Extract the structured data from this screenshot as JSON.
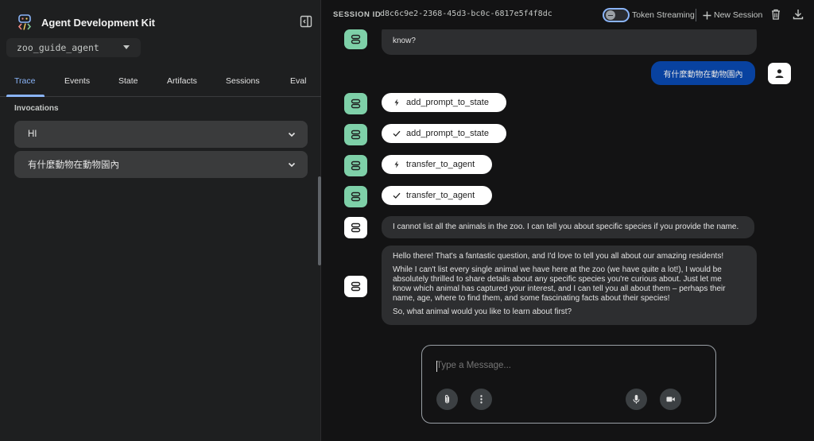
{
  "app": {
    "title": "Agent Development Kit"
  },
  "sidebar": {
    "agent_select": {
      "value": "zoo_guide_agent"
    },
    "tabs": [
      {
        "label": "Trace",
        "active": true
      },
      {
        "label": "Events",
        "active": false
      },
      {
        "label": "State",
        "active": false
      },
      {
        "label": "Artifacts",
        "active": false
      },
      {
        "label": "Sessions",
        "active": false
      },
      {
        "label": "Eval",
        "active": false
      }
    ],
    "invocations_title": "Invocations",
    "invocations": [
      {
        "label": "HI"
      },
      {
        "label": "有什麼動物在動物園內"
      }
    ]
  },
  "topbar": {
    "session_label": "SESSION ID",
    "session_id": "d8c6c9e2-2368-45d3-bc0c-6817e5f4f8dc",
    "token_streaming_label": "Token Streaming",
    "token_streaming_enabled": false,
    "new_session_label": "New Session"
  },
  "chat": {
    "cut_message_tail": "know?",
    "user_message": "有什麼動物在動物園內",
    "tool_calls": [
      {
        "label": "add_prompt_to_state",
        "kind": "call"
      },
      {
        "label": "add_prompt_to_state",
        "kind": "response"
      },
      {
        "label": "transfer_to_agent",
        "kind": "call"
      },
      {
        "label": "transfer_to_agent",
        "kind": "response"
      }
    ],
    "bot_reply_1": "I cannot list all the animals in the zoo. I can tell you about specific species if you provide the name.",
    "bot_reply_2": {
      "p1": "Hello there! That's a fantastic question, and I'd love to tell you all about our amazing residents!",
      "p2_lines": [
        "While I can't list every single animal we have here at the zoo (we have quite a lot!), I would be",
        "absolutely thrilled to share details about any specific species you're curious about. Just let me",
        "know which animal has captured your interest, and I can tell you all about them – perhaps their",
        "name, age, where to find them, and some fascinating facts about their species!"
      ],
      "p3": "So, what animal would you like to learn about first?"
    }
  },
  "composer": {
    "placeholder": "Type a Message..."
  },
  "colors": {
    "accent": "#8ab4f8",
    "agent_avatar": "#7ed0a8",
    "user_bubble": "#0842a0"
  },
  "icons": [
    "adk-logo-icon",
    "sidebar-collapse-icon",
    "chevron-down-icon",
    "bolt-icon",
    "check-icon",
    "bot-icon",
    "person-icon",
    "plus-icon",
    "trash-icon",
    "download-icon",
    "attach-icon",
    "more-vert-icon",
    "mic-icon",
    "videocam-icon"
  ]
}
